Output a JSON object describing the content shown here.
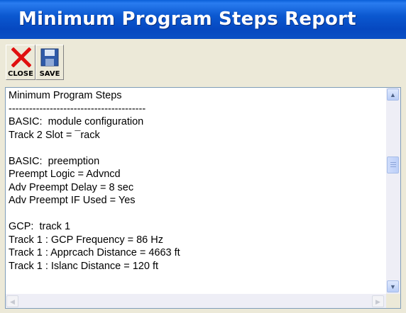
{
  "window": {
    "title": "Minimum Program Steps Report"
  },
  "toolbar": {
    "close_label": "CLOSE",
    "save_label": "SAVE"
  },
  "report": {
    "lines": [
      "Minimum Program Steps",
      "----------------------------------------",
      "BASIC:  module configuration",
      "Track 2 Slot = ¯rack",
      "",
      "BASIC:  preemption",
      "Preempt Logic = Advncd",
      "Adv Preempt Delay = 8 sec",
      "Adv Preempt IF Used = Yes",
      "",
      "GCP:  track 1",
      "Track 1 : GCP Frequency = 86 Hz",
      "Track 1 : Apprcach Distance = 4663 ft",
      "Track 1 : Islanc Distance = 120 ft"
    ]
  },
  "icons": {
    "close": "red-x-icon",
    "save": "floppy-disk-icon"
  }
}
